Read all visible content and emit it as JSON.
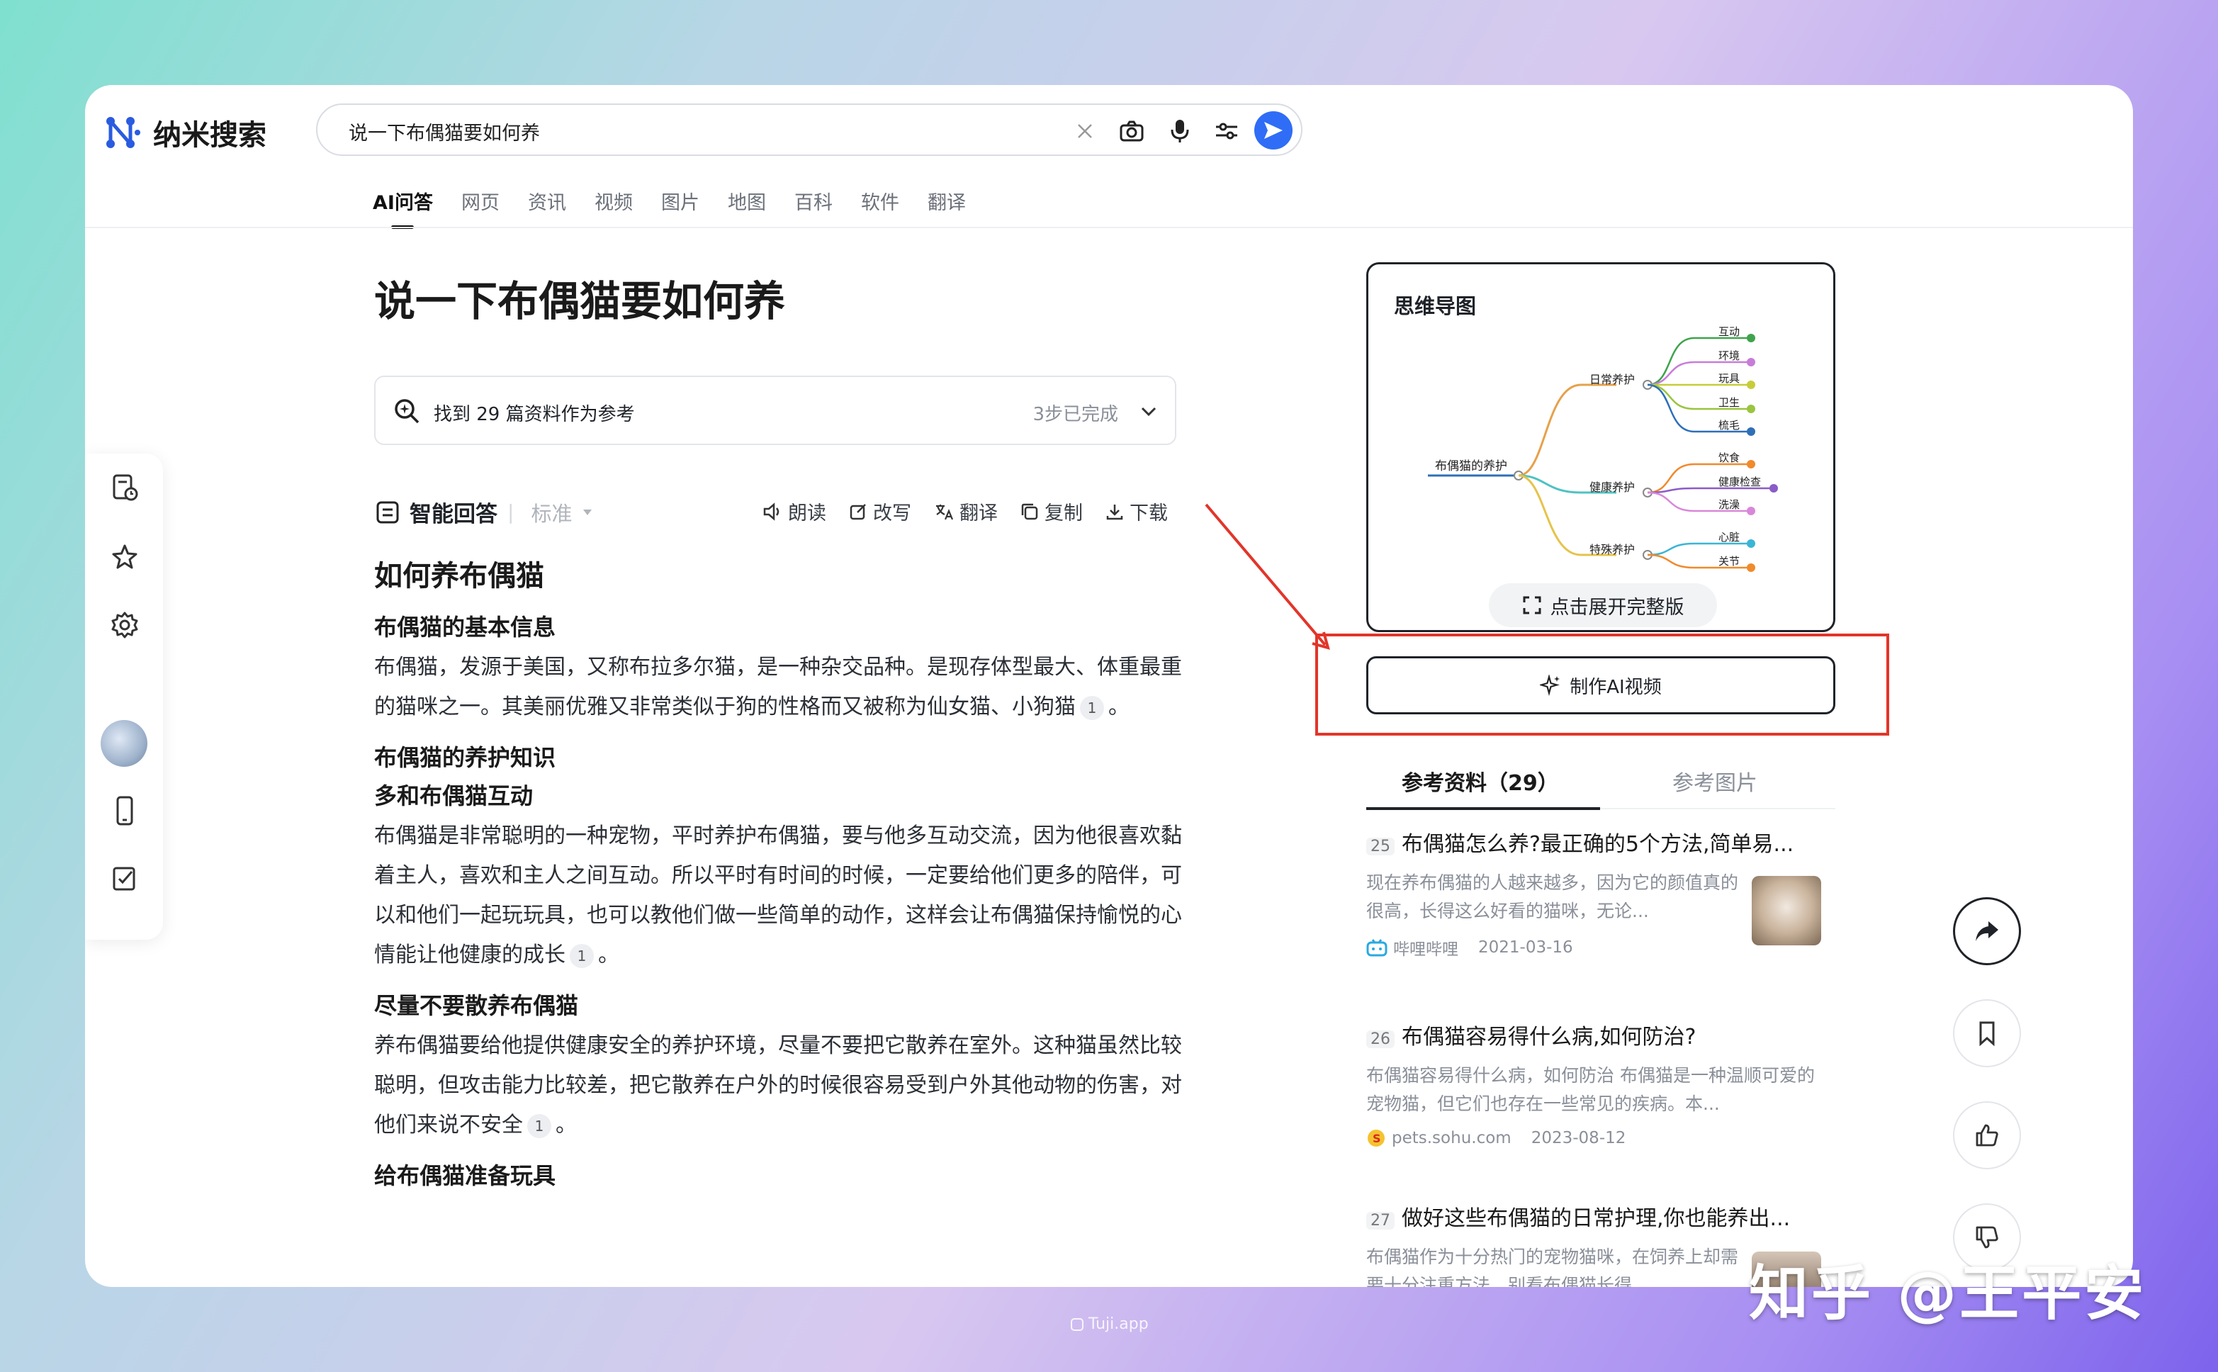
{
  "app": {
    "name": "纳米搜索"
  },
  "search": {
    "query": "说一下布偶猫要如何养"
  },
  "tabs": [
    "AI问答",
    "网页",
    "资讯",
    "视频",
    "图片",
    "地图",
    "百科",
    "软件",
    "翻译"
  ],
  "page_title": "说一下布偶猫要如何养",
  "references_bar": {
    "text": "找到 29 篇资料作为参考",
    "status": "3步已完成"
  },
  "answer_toolbar": {
    "label": "智能回答",
    "mode": "标准",
    "actions": [
      "朗读",
      "改写",
      "翻译",
      "复制",
      "下载"
    ]
  },
  "answer": {
    "heading": "如何养布偶猫",
    "s1_title": "布偶猫的基本信息",
    "s1_text": "布偶猫，发源于美国，又称布拉多尔猫，是一种杂交品种。是现存体型最大、体重最重的猫咪之一。其美丽优雅又非常类似于狗的性格而又被称为仙女猫、小狗猫",
    "s2_title": "布偶猫的养护知识",
    "s3_title": "多和布偶猫互动",
    "s3_text": "布偶猫是非常聪明的一种宠物，平时养护布偶猫，要与他多互动交流，因为他很喜欢黏着主人，喜欢和主人之间互动。所以平时有时间的时候，一定要给他们更多的陪伴，可以和他们一起玩玩具，也可以教他们做一些简单的动作，这样会让布偶猫保持愉悦的心情能让他健康的成长",
    "s4_title": "尽量不要散养布偶猫",
    "s4_text": "养布偶猫要给他提供健康安全的养护环境，尽量不要把它散养在室外。这种猫虽然比较聪明，但攻击能力比较差，把它散养在户外的时候很容易受到户外其他动物的伤害，对他们来说不安全",
    "s5_title": "给布偶猫准备玩具",
    "cite": "1"
  },
  "mindmap": {
    "title": "思维导图",
    "root": "布偶猫的养护",
    "branches": [
      {
        "label": "日常养护",
        "leaves": [
          "互动",
          "环境",
          "玩具",
          "卫生",
          "梳毛"
        ]
      },
      {
        "label": "健康养护",
        "leaves": [
          "饮食",
          "健康检查",
          "洗澡"
        ]
      },
      {
        "label": "特殊养护",
        "leaves": [
          "心脏",
          "关节"
        ]
      }
    ],
    "expand_label": "点击展开完整版",
    "leaf_colors": [
      "#3fa34d",
      "#c77dd8",
      "#c7cc3a",
      "#9bc43f",
      "#2e6fb8",
      "#f08a2c",
      "#8a5cc7",
      "#d987d9",
      "#3bb5d6",
      "#f08a2c"
    ],
    "branch_colors": [
      "#e6a14a",
      "#4fc2c2",
      "#e6c34a"
    ]
  },
  "video_button": "制作AI视频",
  "ref_tabs": {
    "active": "参考资料（29）",
    "inactive": "参考图片"
  },
  "references": [
    {
      "num": "25",
      "title": "布偶猫怎么养?最正确的5个方法,简单易...",
      "snippet": "现在养布偶猫的人越来越多，因为它的颜值真的很高，长得这么好看的猫咪，无论...",
      "source": "哔哩哔哩",
      "date": "2021-03-16"
    },
    {
      "num": "26",
      "title": "布偶猫容易得什么病,如何防治?",
      "snippet": "布偶猫容易得什么病，如何防治 布偶猫是一种温顺可爱的宠物猫，但它们也存在一些常见的疾病。本...",
      "source": "pets.sohu.com",
      "date": "2023-08-12"
    },
    {
      "num": "27",
      "title": "做好这些布偶猫的日常护理,你也能养出...",
      "snippet": "布偶猫作为十分热门的宠物猫咪，在饲养上却需要十分注重方法，别看布偶猫长得"
    }
  ],
  "watermark": "知乎 @王平安",
  "footer_credit": "Tuji.app",
  "colors": {
    "accent": "#2f6df6",
    "annotation_red": "#e2352a"
  }
}
